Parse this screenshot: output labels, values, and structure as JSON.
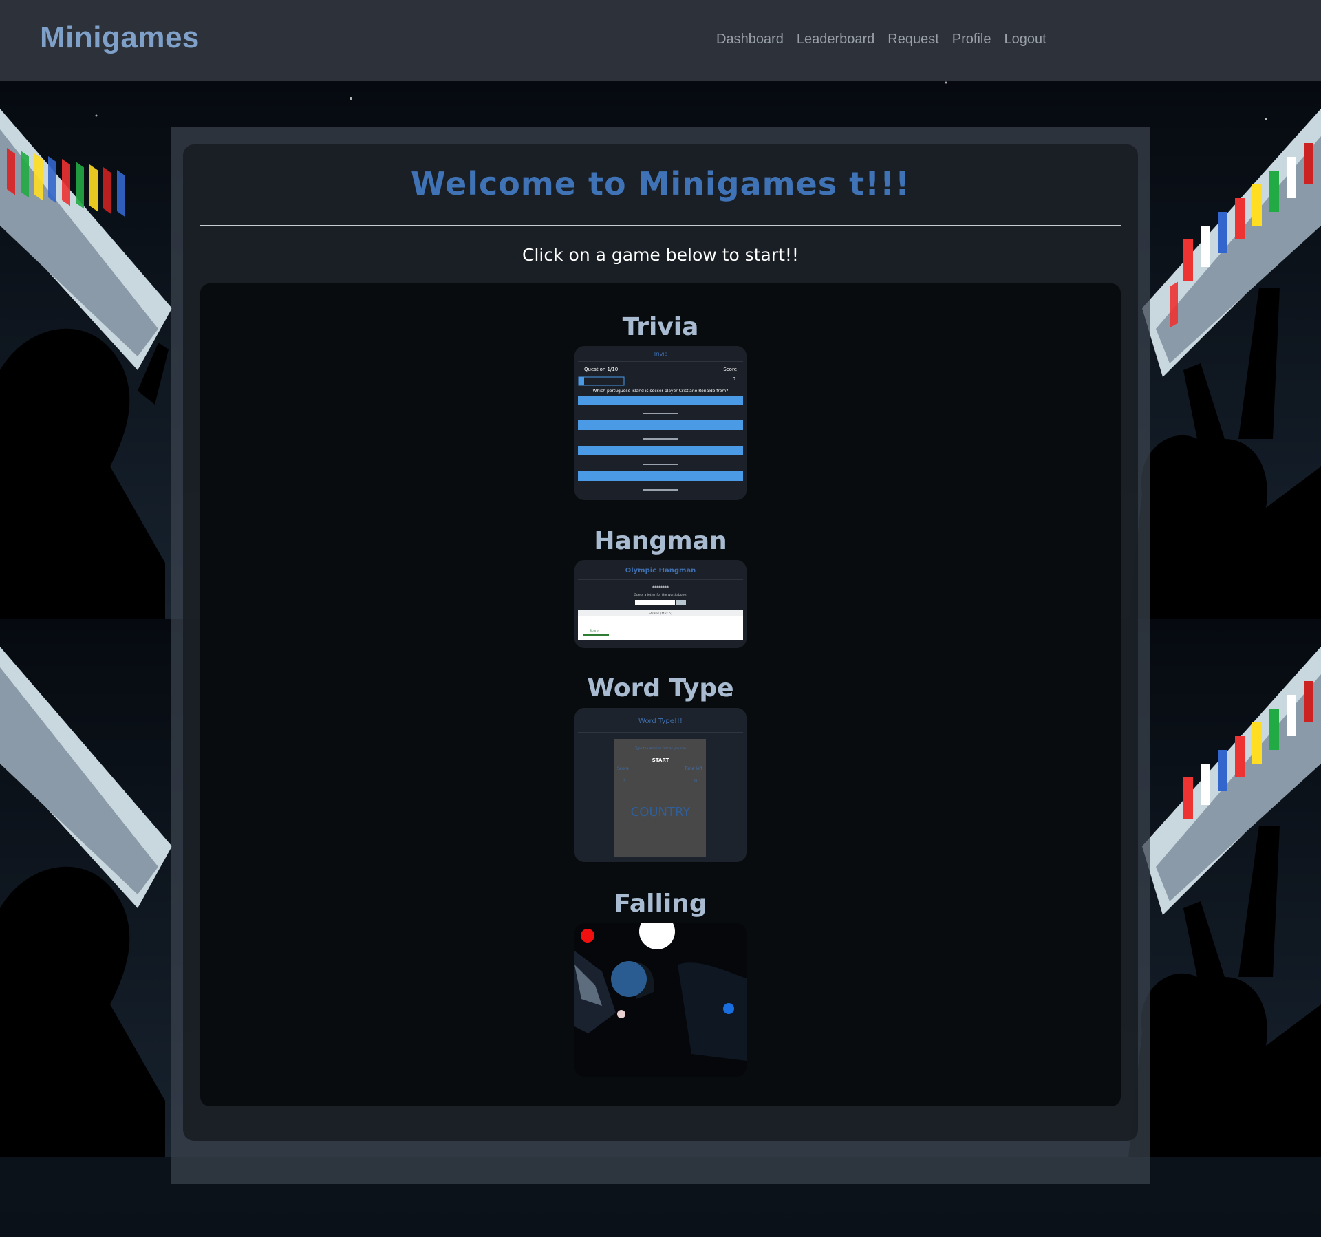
{
  "navbar": {
    "brand": "Minigames",
    "links": [
      "Dashboard",
      "Leaderboard",
      "Request",
      "Profile",
      "Logout"
    ]
  },
  "main": {
    "welcome": "Welcome to Minigames t!!!",
    "subtitle": "Click on a game below to start!!"
  },
  "games": [
    {
      "title": "Trivia",
      "preview": {
        "heading": "Trivia",
        "question_label": "Question 1/10",
        "score_label": "Score",
        "score_value": "0",
        "question": "Which portuguese island is soccer player Cristiano Ronaldo from?"
      }
    },
    {
      "title": "Hangman",
      "preview": {
        "heading": "Olympic Hangman",
        "word": "********",
        "prompt": "Guess a letter for the word above:",
        "strikes": "Strikes (Max 5)",
        "score_label": "Score"
      }
    },
    {
      "title": "Word Type",
      "preview": {
        "heading": "Word Type!!!",
        "instruction": "Type the word as fast as you can",
        "start": "START",
        "left_label": "Score",
        "right_label": "Time left",
        "left_value": "0",
        "right_value": "0",
        "word": "COUNTRY"
      }
    },
    {
      "title": "Falling"
    }
  ],
  "colors": {
    "navbar_bg": "#2d323a",
    "brand": "#7fa0c8",
    "welcome": "#3f73b6",
    "trivia_button": "#4a9ae6",
    "falling_blue": "#2b5c91",
    "falling_red": "#f01010"
  }
}
